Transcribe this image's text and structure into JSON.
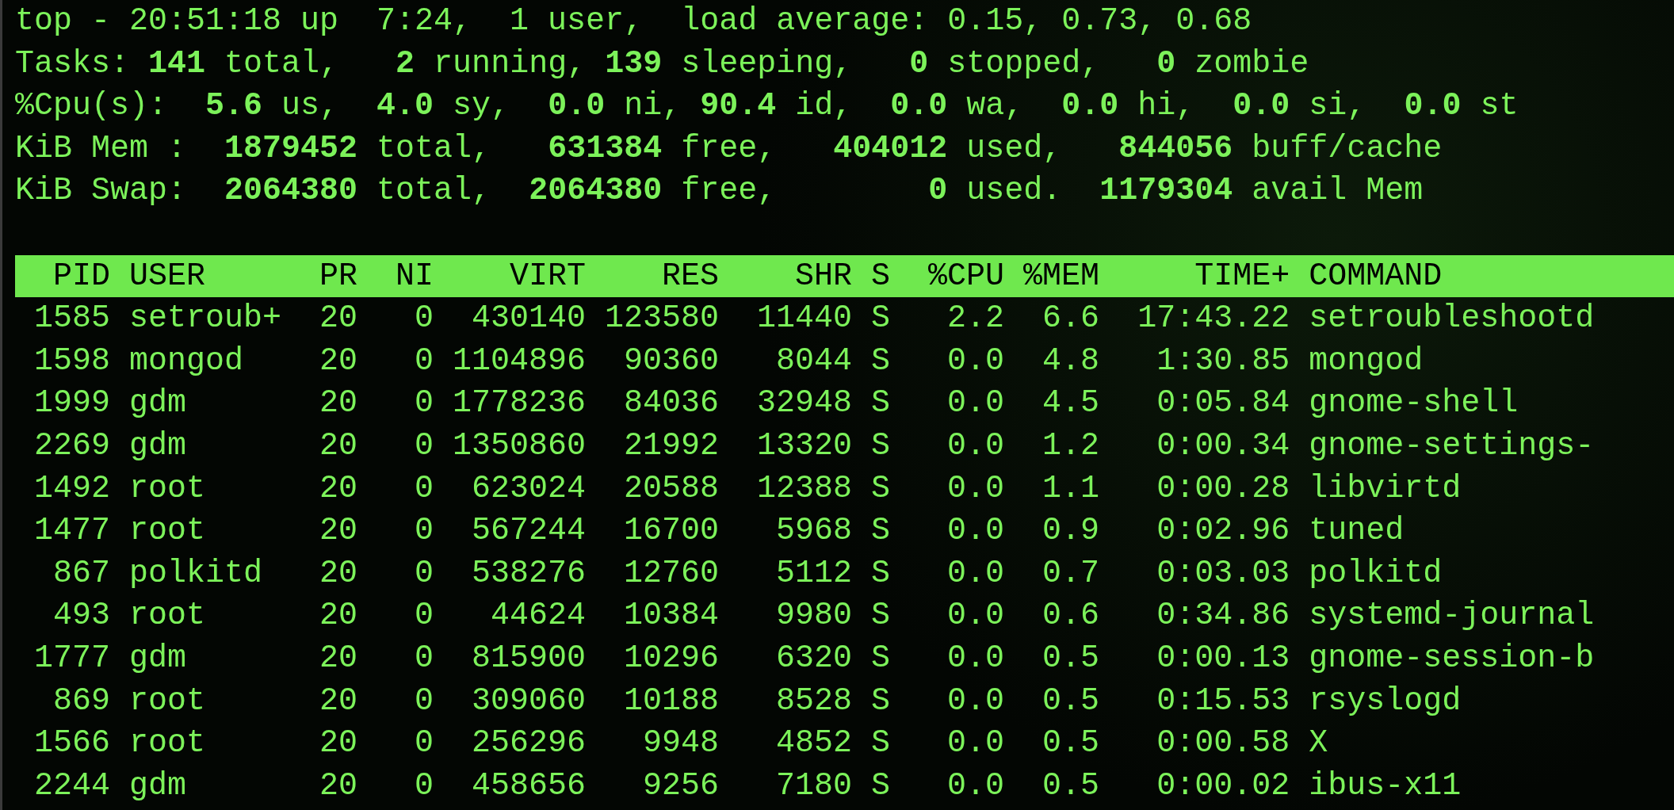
{
  "summary_lines": [
    "top - 20:51:18 up  7:24,  1 user,  load average: 0.15, 0.73, 0.68",
    "Tasks: **141** total,   **2** running, **139** sleeping,   **0** stopped,   **0** zombie",
    "%Cpu(s):  **5.6** us,  **4.0** sy,  **0.0** ni, **90.4** id,  **0.0** wa,  **0.0** hi,  **0.0** si,  **0.0** st",
    "KiB Mem :  **1879452** total,   **631384** free,   **404012** used,   **844056** buff/cache",
    "KiB Swap:  **2064380** total,  **2064380** free,        **0** used.  **1179304** avail Mem"
  ],
  "table": {
    "columns": [
      "PID",
      "USER",
      "PR",
      "NI",
      "VIRT",
      "RES",
      "SHR",
      "S",
      "%CPU",
      "%MEM",
      "TIME+",
      "COMMAND"
    ],
    "rows": [
      [
        "1585",
        "setroub+",
        "20",
        "0",
        "430140",
        "123580",
        "11440",
        "S",
        "2.2",
        "6.6",
        "17:43.22",
        "setroubleshootd"
      ],
      [
        "1598",
        "mongod",
        "20",
        "0",
        "1104896",
        "90360",
        "8044",
        "S",
        "0.0",
        "4.8",
        "1:30.85",
        "mongod"
      ],
      [
        "1999",
        "gdm",
        "20",
        "0",
        "1778236",
        "84036",
        "32948",
        "S",
        "0.0",
        "4.5",
        "0:05.84",
        "gnome-shell"
      ],
      [
        "2269",
        "gdm",
        "20",
        "0",
        "1350860",
        "21992",
        "13320",
        "S",
        "0.0",
        "1.2",
        "0:00.34",
        "gnome-settings-"
      ],
      [
        "1492",
        "root",
        "20",
        "0",
        "623024",
        "20588",
        "12388",
        "S",
        "0.0",
        "1.1",
        "0:00.28",
        "libvirtd"
      ],
      [
        "1477",
        "root",
        "20",
        "0",
        "567244",
        "16700",
        "5968",
        "S",
        "0.0",
        "0.9",
        "0:02.96",
        "tuned"
      ],
      [
        "867",
        "polkitd",
        "20",
        "0",
        "538276",
        "12760",
        "5112",
        "S",
        "0.0",
        "0.7",
        "0:03.03",
        "polkitd"
      ],
      [
        "493",
        "root",
        "20",
        "0",
        "44624",
        "10384",
        "9980",
        "S",
        "0.0",
        "0.6",
        "0:34.86",
        "systemd-journal"
      ],
      [
        "1777",
        "gdm",
        "20",
        "0",
        "815900",
        "10296",
        "6320",
        "S",
        "0.0",
        "0.5",
        "0:00.13",
        "gnome-session-b"
      ],
      [
        "869",
        "root",
        "20",
        "0",
        "309060",
        "10188",
        "8528",
        "S",
        "0.0",
        "0.5",
        "0:15.53",
        "rsyslogd"
      ],
      [
        "1566",
        "root",
        "20",
        "0",
        "256296",
        "9948",
        "4852",
        "S",
        "0.0",
        "0.5",
        "0:00.58",
        "X"
      ],
      [
        "2244",
        "gdm",
        "20",
        "0",
        "458656",
        "9256",
        "7180",
        "S",
        "0.0",
        "0.5",
        "0:00.02",
        "ibus-x11"
      ]
    ]
  }
}
